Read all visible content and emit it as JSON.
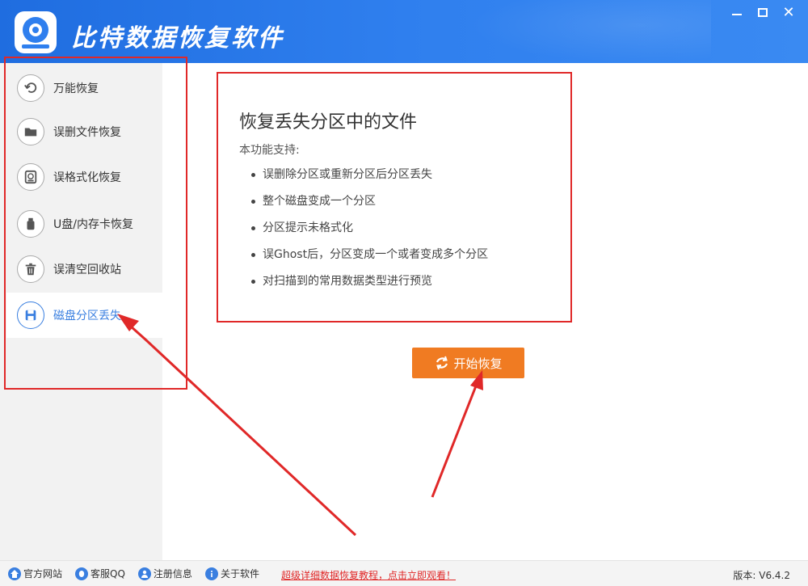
{
  "window": {
    "title": "比特数据恢复软件",
    "colors": {
      "titlebar": "#2f7fee",
      "accent": "#3a7fe0",
      "button": "#f07b22",
      "annotation": "#e02828"
    }
  },
  "sidebar": {
    "items": [
      {
        "label": "万能恢复",
        "icon": "undo-icon",
        "active": false
      },
      {
        "label": "误删文件恢复",
        "icon": "folder-icon",
        "active": false
      },
      {
        "label": "误格式化恢复",
        "icon": "disk-restore-icon",
        "active": false
      },
      {
        "label": "U盘/内存卡恢复",
        "icon": "usb-drive-icon",
        "active": false
      },
      {
        "label": "误清空回收站",
        "icon": "trash-icon",
        "active": false
      },
      {
        "label": "磁盘分区丢失",
        "icon": "save-disk-icon",
        "active": true
      }
    ]
  },
  "main": {
    "title": "恢复丢失分区中的文件",
    "subtitle": "本功能支持:",
    "features": [
      "误删除分区或重新分区后分区丢失",
      "整个磁盘变成一个分区",
      "分区提示未格式化",
      "误Ghost后，分区变成一个或者变成多个分区",
      "对扫描到的常用数据类型进行预览"
    ],
    "start_button": "开始恢复"
  },
  "footer": {
    "links": [
      {
        "label": "官方网站",
        "icon": "home-icon"
      },
      {
        "label": "客服QQ",
        "icon": "qq-icon"
      },
      {
        "label": "注册信息",
        "icon": "user-icon"
      },
      {
        "label": "关于软件",
        "icon": "info-icon"
      }
    ],
    "banner": "超级详细数据恢复教程，点击立即观看！",
    "version": "版本: V6.4.2"
  }
}
